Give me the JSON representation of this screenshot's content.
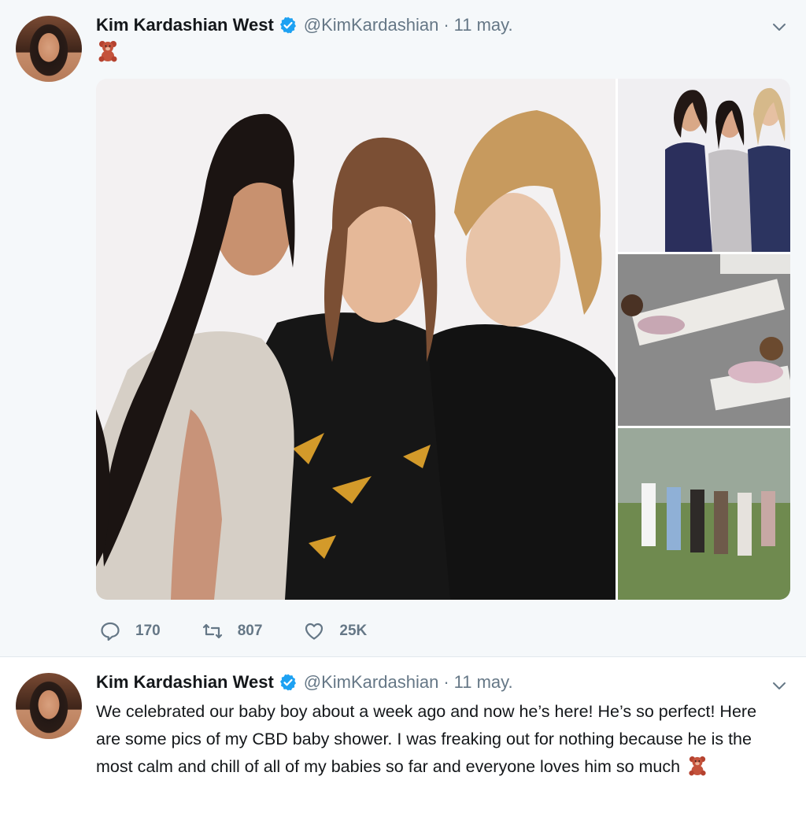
{
  "tweets": [
    {
      "author": {
        "name": "Kim Kardashian West",
        "handle": "@KimKardashian",
        "verified": true
      },
      "date": "11 may.",
      "separator": "·",
      "text_emoji": "teddy-bear-emoji",
      "media": [
        {
          "icon": "photo-three-women"
        },
        {
          "icon": "photo-three-women-posing"
        },
        {
          "icon": "photo-kids-on-mats"
        },
        {
          "icon": "photo-group-walking-outdoors"
        }
      ],
      "actions": {
        "replies": "170",
        "retweets": "807",
        "likes": "25K"
      }
    },
    {
      "author": {
        "name": "Kim Kardashian West",
        "handle": "@KimKardashian",
        "verified": true
      },
      "date": "11 may.",
      "separator": "·",
      "text": "We celebrated our baby boy about a week ago and now he’s here! He’s so perfect!  Here are some pics of my CBD baby shower. I was freaking out for nothing because he is the most calm and chill of all of my babies so far and everyone loves him so much"
    }
  ],
  "colors": {
    "background": "#f5f8fa",
    "secondary_text": "#657786",
    "verified_blue": "#1da1f2",
    "divider": "#e1e8ed"
  }
}
